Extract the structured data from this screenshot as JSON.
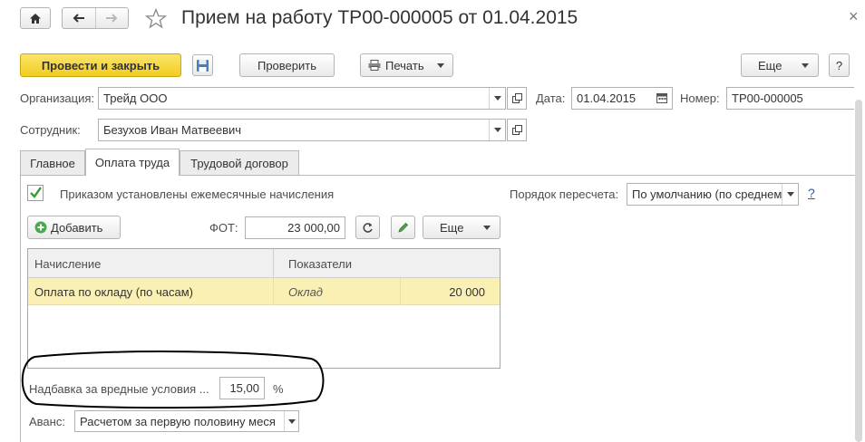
{
  "window": {
    "title": "Прием на работу ТР00-000005 от 01.04.2015",
    "close_glyph": "×"
  },
  "toolbar": {
    "post_close_label": "Провести и закрыть",
    "check_label": "Проверить",
    "print_label": "Печать",
    "more_label": "Еще",
    "help_label": "?"
  },
  "header": {
    "org_label": "Организация:",
    "org_value": "Трейд ООО",
    "date_label": "Дата:",
    "date_value": "01.04.2015",
    "number_label": "Номер:",
    "number_value": "ТР00-000005",
    "employee_label": "Сотрудник:",
    "employee_value": "Безухов Иван Матвеевич"
  },
  "tabs": [
    {
      "label": "Главное",
      "active": false
    },
    {
      "label": "Оплата труда",
      "active": true
    },
    {
      "label": "Трудовой договор",
      "active": false
    }
  ],
  "pay": {
    "checkbox_label": "Приказом установлены ежемесячные начисления",
    "checkbox_checked": true,
    "recalc_label": "Порядок пересчета:",
    "recalc_value": "По умолчанию (по среднем",
    "recalc_help": "?",
    "add_label": "Добавить",
    "fot_label": "ФОТ:",
    "fot_value": "23 000,00",
    "more_label": "Еще",
    "table": {
      "columns": [
        "Начисление",
        "Показатели"
      ],
      "rows": [
        {
          "accrual": "Оплата по окладу (по часам)",
          "indicator": "Оклад",
          "value": "20 000"
        }
      ]
    },
    "bonus_label": "Надбавка за вредные условия ...",
    "bonus_value": "15,00",
    "bonus_unit": "%",
    "advance_label": "Аванс:",
    "advance_value": "Расчетом за первую половину меся"
  },
  "colors": {
    "primary_button": "#f5d740",
    "selected_row": "#fbf0b4",
    "checkbox_accent": "#3a9a3a"
  }
}
